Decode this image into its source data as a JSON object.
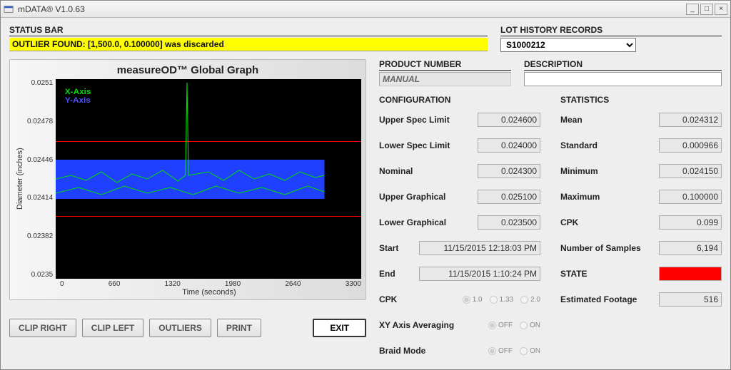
{
  "window": {
    "title": "mDATA® V1.0.63"
  },
  "status": {
    "heading": "STATUS BAR",
    "message": "OUTLIER FOUND: [1,500.0, 0.100000] was discarded"
  },
  "lot_history": {
    "heading": "LOT HISTORY RECORDS",
    "selected": "S1000212"
  },
  "product": {
    "number_heading": "PRODUCT NUMBER",
    "number_value": "MANUAL",
    "description_heading": "DESCRIPTION",
    "description_value": ""
  },
  "chart": {
    "title": "measureOD™ Global Graph",
    "ylabel": "Diameter (inches)",
    "xlabel": "Time (seconds)",
    "legend_x": "X-Axis",
    "legend_y": "Y-Axis"
  },
  "buttons": {
    "clip_right": "CLIP RIGHT",
    "clip_left": "CLIP LEFT",
    "outliers": "OUTLIERS",
    "print": "PRINT",
    "exit": "EXIT"
  },
  "config": {
    "heading": "CONFIGURATION",
    "upper_spec": {
      "label": "Upper Spec Limit",
      "value": "0.024600"
    },
    "lower_spec": {
      "label": "Lower Spec Limit",
      "value": "0.024000"
    },
    "nominal": {
      "label": "Nominal",
      "value": "0.024300"
    },
    "upper_graph": {
      "label": "Upper Graphical",
      "value": "0.025100"
    },
    "lower_graph": {
      "label": "Lower Graphical",
      "value": "0.023500"
    },
    "start": {
      "label": "Start",
      "value": "11/15/2015 12:18:03 PM"
    },
    "end": {
      "label": "End",
      "value": "11/15/2015 1:10:24 PM"
    },
    "cpk": {
      "label": "CPK",
      "options": [
        "1.0",
        "1.33",
        "2.0"
      ],
      "selected": "1.0"
    },
    "xy_avg": {
      "label": "XY Axis Averaging",
      "options": [
        "OFF",
        "ON"
      ],
      "selected": "OFF"
    },
    "braid": {
      "label": "Braid Mode",
      "options": [
        "OFF",
        "ON"
      ],
      "selected": "OFF"
    }
  },
  "stats": {
    "heading": "STATISTICS",
    "mean": {
      "label": "Mean",
      "value": "0.024312"
    },
    "std": {
      "label": "Standard",
      "value": "0.000966"
    },
    "min": {
      "label": "Minimum",
      "value": "0.024150"
    },
    "max": {
      "label": "Maximum",
      "value": "0.100000"
    },
    "cpk": {
      "label": "CPK",
      "value": "0.099"
    },
    "samples": {
      "label": "Number of Samples",
      "value": "6,194"
    },
    "state": {
      "label": "STATE",
      "color": "#ff0000"
    },
    "footage": {
      "label": "Estimated Footage",
      "value": "516"
    }
  },
  "chart_data": {
    "type": "line",
    "title": "measureOD™ Global Graph",
    "xlabel": "Time (seconds)",
    "ylabel": "Diameter (inches)",
    "xlim": [
      0,
      3300
    ],
    "ylim": [
      0.0235,
      0.0251
    ],
    "xticks": [
      0,
      660,
      1320,
      1980,
      2640,
      3300
    ],
    "yticks": [
      0.0235,
      0.02382,
      0.02414,
      0.02446,
      0.02478,
      0.0251
    ],
    "spec_lines": {
      "upper": 0.0246,
      "lower": 0.024,
      "color": "#ff0000"
    },
    "series": [
      {
        "name": "X-Axis",
        "color": "#00e000",
        "x": [
          0,
          300,
          600,
          900,
          1200,
          1400,
          1405,
          1410,
          1700,
          2000,
          2300,
          2600,
          2900
        ],
        "y": [
          0.0243,
          0.02432,
          0.02428,
          0.02435,
          0.02431,
          0.0244,
          0.0251,
          0.02438,
          0.02433,
          0.02429,
          0.02434,
          0.0243,
          0.02432
        ]
      },
      {
        "name": "Y-Axis",
        "color": "#4060ff",
        "x": [
          0,
          300,
          600,
          900,
          1200,
          1500,
          1800,
          2100,
          2400,
          2700,
          2900
        ],
        "y": [
          0.0242,
          0.02445,
          0.02418,
          0.0244,
          0.02425,
          0.02442,
          0.02422,
          0.02444,
          0.0242,
          0.02438,
          0.0243
        ]
      }
    ],
    "data_xrange_visible": [
      0,
      2900
    ]
  }
}
